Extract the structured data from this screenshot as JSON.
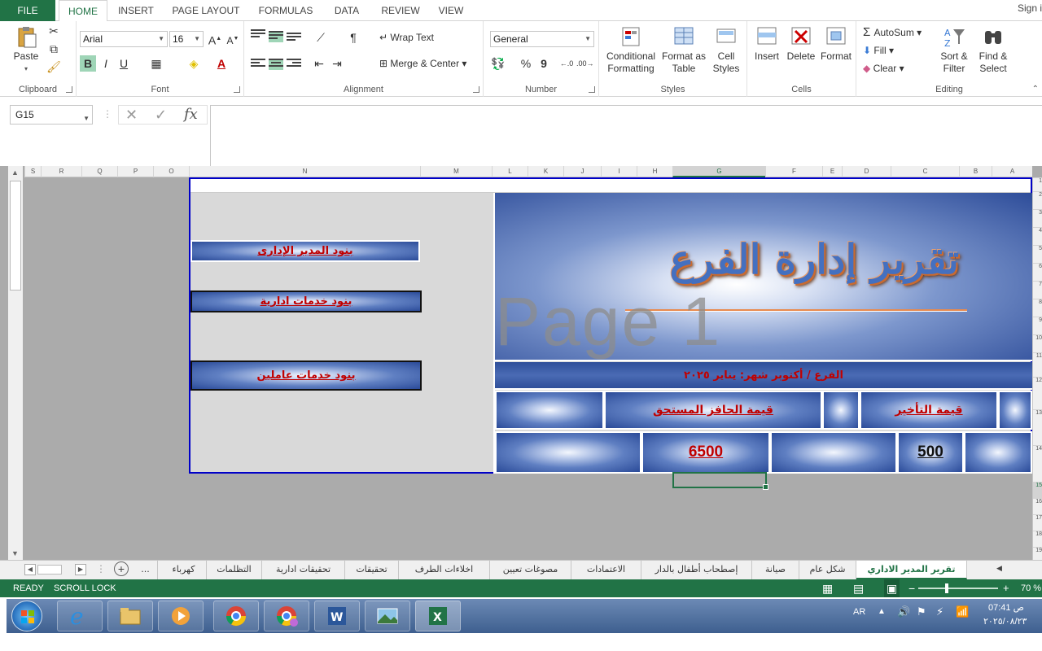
{
  "ribbon_tabs": [
    "FILE",
    "HOME",
    "INSERT",
    "PAGE LAYOUT",
    "FORMULAS",
    "DATA",
    "REVIEW",
    "VIEW"
  ],
  "signin": "Sign i",
  "clipboard": {
    "paste": "Paste",
    "label": "Clipboard"
  },
  "font": {
    "name": "Arial",
    "size": "16",
    "label": "Font",
    "bold": "B",
    "italic": "I",
    "underline": "U"
  },
  "alignment": {
    "wrap": "Wrap Text",
    "merge": "Merge & Center",
    "label": "Alignment"
  },
  "number": {
    "format": "General",
    "percent": "%",
    "comma": "9",
    "label": "Number"
  },
  "styles": {
    "conditional": "Conditional Formatting",
    "format_table": "Format as Table",
    "cell_styles": "Cell Styles",
    "label": "Styles"
  },
  "cells": {
    "insert": "Insert",
    "delete": "Delete",
    "format": "Format",
    "label": "Cells"
  },
  "editing": {
    "autosum": "AutoSum",
    "fill": "Fill",
    "clear": "Clear",
    "sort": "Sort & Filter",
    "find": "Find & Select",
    "label": "Editing"
  },
  "namebox": "G15",
  "columns": [
    "S",
    "R",
    "Q",
    "P",
    "O",
    "N",
    "M",
    "L",
    "K",
    "J",
    "I",
    "H",
    "G",
    "F",
    "E",
    "D",
    "C",
    "B",
    "A"
  ],
  "rows": [
    "1",
    "2",
    "3",
    "4",
    "5",
    "6",
    "7",
    "8",
    "9",
    "10",
    "11",
    "12",
    "13",
    "14",
    "15",
    "16",
    "17",
    "18",
    "19"
  ],
  "left_buttons": [
    "بنود المدير الإدارى",
    "بنود خدمات ادارية",
    "بنود خدمات عاملين"
  ],
  "report": {
    "title": "تقرير إدارة الفرع",
    "watermark": "Page 1",
    "subtitle": "الفرع / أكتوبر  شهر: يناير ٢٠٢٥",
    "header_delay": "قيمة التأخير",
    "header_incentive": "قيمة الحافز المستحق",
    "value_delay": "500",
    "value_incentive": "6500"
  },
  "sheet_tabs": [
    "تقرير المدير الاداري",
    "شكل عام",
    "صيانة",
    "إصطحاب أطفال بالدار",
    "الاعتمادات",
    "مصوغات تعيين",
    "اخلاءات الطرف",
    "تحقيقات",
    "تحقيقات ادارية",
    "التظلمات",
    "كهرباء",
    "..."
  ],
  "status": {
    "ready": "READY",
    "scroll": "SCROLL LOCK",
    "zoom": "70 %"
  },
  "tray": {
    "lang": "AR",
    "time": "07:41 ص",
    "date": "٢٠٢٥/٠٨/٢٣"
  },
  "colors": {
    "excel_green": "#217346",
    "border_blue": "#0000c8",
    "label_red": "#c00000"
  },
  "icons": [
    "windows-start-icon",
    "ie-icon",
    "explorer-icon",
    "media-player-icon",
    "chrome-icon",
    "chrome-profile-icon",
    "word-icon",
    "photos-icon",
    "excel-icon"
  ]
}
